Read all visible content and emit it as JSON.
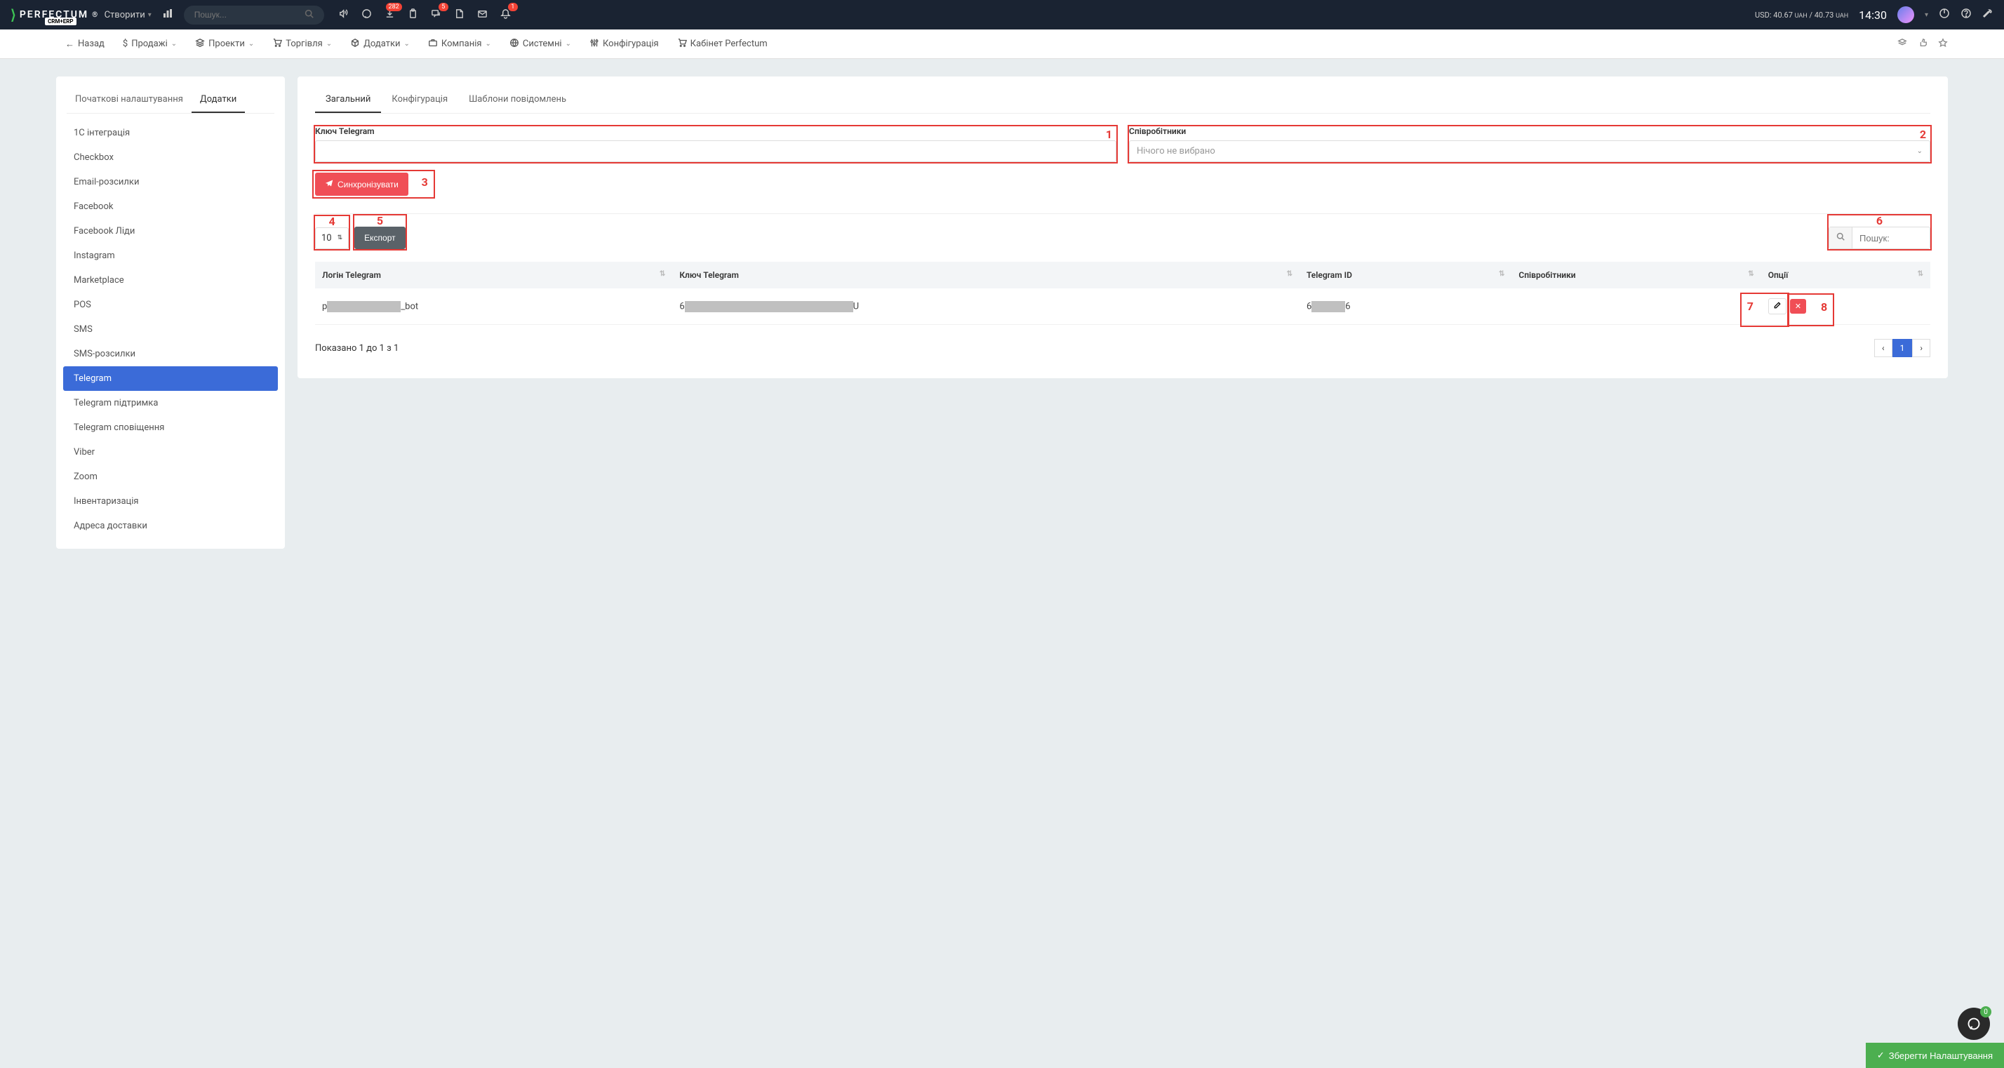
{
  "header": {
    "create_label": "Створити",
    "search_placeholder": "Пошук...",
    "badges": {
      "download": "282",
      "chat": "5",
      "bell": "1"
    },
    "currency_prefix": "USD:",
    "currency_buy": "40.67",
    "currency_unit": "UAH",
    "currency_sep": "/",
    "currency_sell": "40.73",
    "time": "14:30",
    "chat_bubble_count": "0"
  },
  "menu": [
    "Назад",
    "Продажі",
    "Проекти",
    "Торгівля",
    "Додатки",
    "Компанія",
    "Системні",
    "Конфігурація",
    "Кабінет Perfectum"
  ],
  "sidebar": {
    "tabs": [
      "Початкові налаштування",
      "Додатки"
    ],
    "tabs_active_index": 1,
    "items": [
      "1С інтеграція",
      "Checkbox",
      "Email-розсилки",
      "Facebook",
      "Facebook Ліди",
      "Instagram",
      "Marketplace",
      "POS",
      "SMS",
      "SMS-розсилки",
      "Telegram",
      "Telegram підтримка",
      "Telegram сповіщення",
      "Viber",
      "Zoom",
      "Інвентаризація",
      "Адреса доставки"
    ],
    "active_index": 10
  },
  "content": {
    "tabs": [
      "Загальний",
      "Конфігурація",
      "Шаблони повідомлень"
    ],
    "key_label": "Ключ Telegram",
    "staff_label": "Співробітники",
    "staff_placeholder": "Нічого не вибрано",
    "sync_label": "Синхронізувати",
    "page_size": "10",
    "export_label": "Експорт",
    "search_placeholder": "Пошук:",
    "columns": [
      "Логін Telegram",
      "Ключ Telegram",
      "Telegram ID",
      "Співробітники",
      "Опції"
    ],
    "rows": [
      {
        "login_pre": "p",
        "login_suf": "_bot",
        "key_pre": "6",
        "key_suf": "U",
        "id_pre": "6",
        "id_suf": "6",
        "staff": ""
      }
    ],
    "footer_text": "Показано 1 до 1 з 1",
    "page_current": "1"
  },
  "annotations": {
    "n1": "1",
    "n2": "2",
    "n3": "3",
    "n4": "4",
    "n5": "5",
    "n6": "6",
    "n7": "7",
    "n8": "8"
  },
  "save_label": "Зберегти Налаштування"
}
